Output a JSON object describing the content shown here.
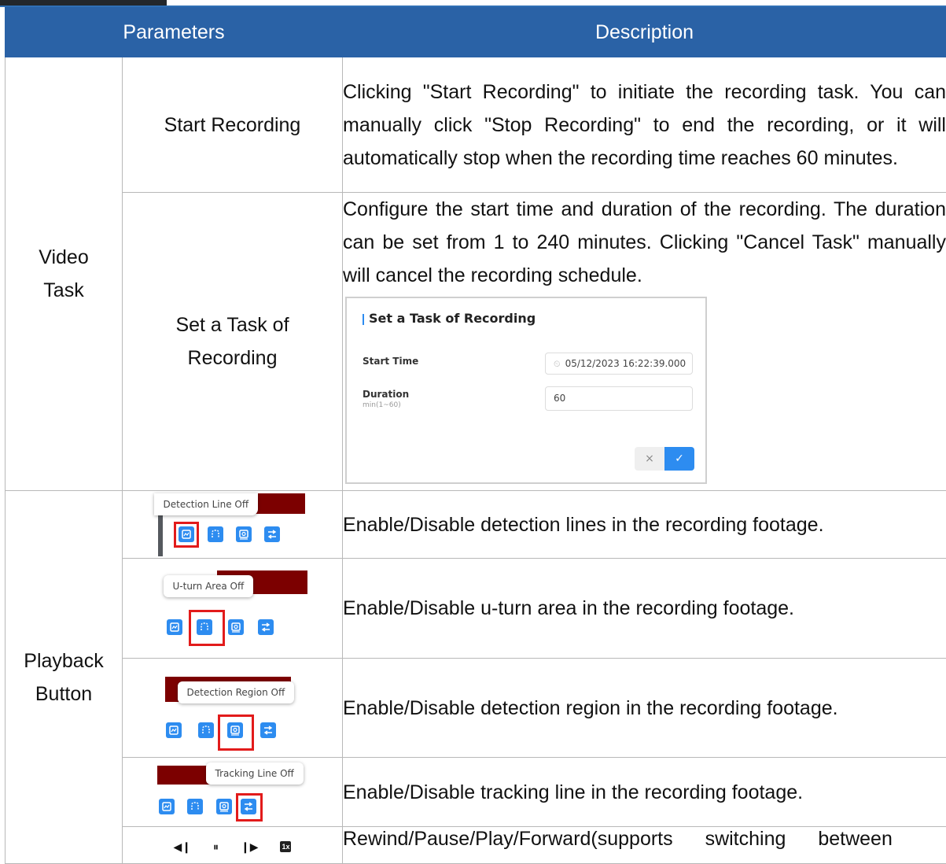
{
  "header": {
    "parameters": "Parameters",
    "description": "Description"
  },
  "video_task": {
    "label_line1": "Video",
    "label_line2": "Task",
    "start_recording": {
      "name": "Start Recording",
      "description": "Clicking \"Start Recording\" to initiate the recording task. You can manually click \"Stop Recording\" to end the recording, or it will automatically stop when the recording time reaches 60 minutes."
    },
    "set_task": {
      "name_line1": "Set a Task of",
      "name_line2": "Recording",
      "description": "Configure the start time and duration of the recording. The duration can be set from 1 to 240 minutes. Clicking \"Cancel Task\" manually will cancel the recording schedule.",
      "dialog": {
        "title": "Set a Task of Recording",
        "start_time_label": "Start Time",
        "start_time_value": "05/12/2023 16:22:39.000",
        "duration_label": "Duration",
        "duration_hint": "min(1~60)",
        "duration_value": "60",
        "cancel_glyph": "×",
        "ok_glyph": "✓"
      }
    }
  },
  "playback": {
    "label_line1": "Playback",
    "label_line2": "Button",
    "rows": [
      {
        "tooltip": "Detection Line Off",
        "description": "Enable/Disable detection lines in the recording footage."
      },
      {
        "tooltip": "U-turn Area Off",
        "description": "Enable/Disable u-turn area in the recording footage."
      },
      {
        "tooltip": "Detection Region Off",
        "description": "Enable/Disable detection region in the recording footage."
      },
      {
        "tooltip": "Tracking Line Off",
        "description": "Enable/Disable tracking line in the recording footage."
      }
    ],
    "controls": {
      "rewind_glyph": "◀❙",
      "pause_glyph": "⏸",
      "play_glyph": "❙▶",
      "speed_label": "1x",
      "description": "Rewind/Pause/Play/Forward(supports switching between"
    }
  },
  "colors": {
    "header_blue": "#2a62a6",
    "highlight_red": "#e21b1b",
    "icon_blue": "#2d8cf0",
    "dark_red": "#7c0000"
  }
}
